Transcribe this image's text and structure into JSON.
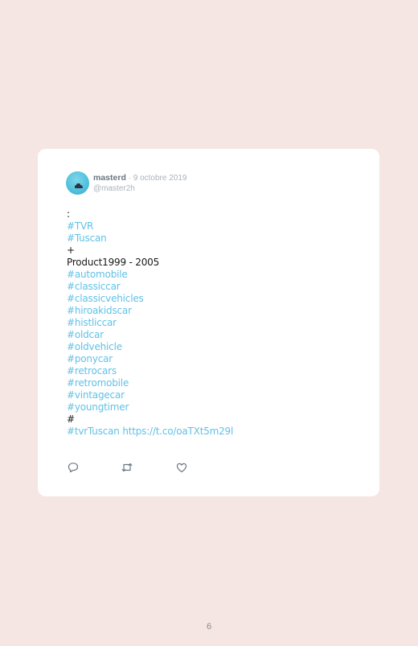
{
  "tweet": {
    "author_name": "masterd",
    "separator": " · ",
    "date": "9 octobre 2019",
    "handle": "@master2h",
    "lines": [
      {
        "text": ":",
        "type": "plain"
      },
      {
        "text": "#TVR",
        "type": "tag"
      },
      {
        "text": "#Tuscan",
        "type": "tag"
      },
      {
        "text": "+",
        "type": "plain"
      },
      {
        "text": "Product1999 - 2005",
        "type": "plain"
      },
      {
        "text": "#automobile",
        "type": "tag"
      },
      {
        "text": "#classiccar",
        "type": "tag"
      },
      {
        "text": "#classicvehicles",
        "type": "tag"
      },
      {
        "text": "#hiroakidscar",
        "type": "tag"
      },
      {
        "text": "#histliccar",
        "type": "tag"
      },
      {
        "text": "#oldcar",
        "type": "tag"
      },
      {
        "text": "#oldvehicle",
        "type": "tag"
      },
      {
        "text": "#ponycar",
        "type": "tag"
      },
      {
        "text": "#retrocars",
        "type": "tag"
      },
      {
        "text": "#retromobile",
        "type": "tag"
      },
      {
        "text": "#vintagecar",
        "type": "tag"
      },
      {
        "text": "#youngtimer",
        "type": "tag"
      },
      {
        "text": "#",
        "type": "plain"
      },
      {
        "text": "#tvrTuscan https://t.co/oaTXt5m29l",
        "type": "tag"
      }
    ],
    "actions": {
      "reply_icon": "reply-icon",
      "retweet_icon": "retweet-icon",
      "like_icon": "like-icon"
    }
  },
  "page": {
    "number": "6"
  },
  "colors": {
    "background": "#f5e6e3",
    "card": "#ffffff",
    "hashtag": "#5fc1e6",
    "text": "#1a1a1a",
    "muted": "#aab3bb"
  }
}
